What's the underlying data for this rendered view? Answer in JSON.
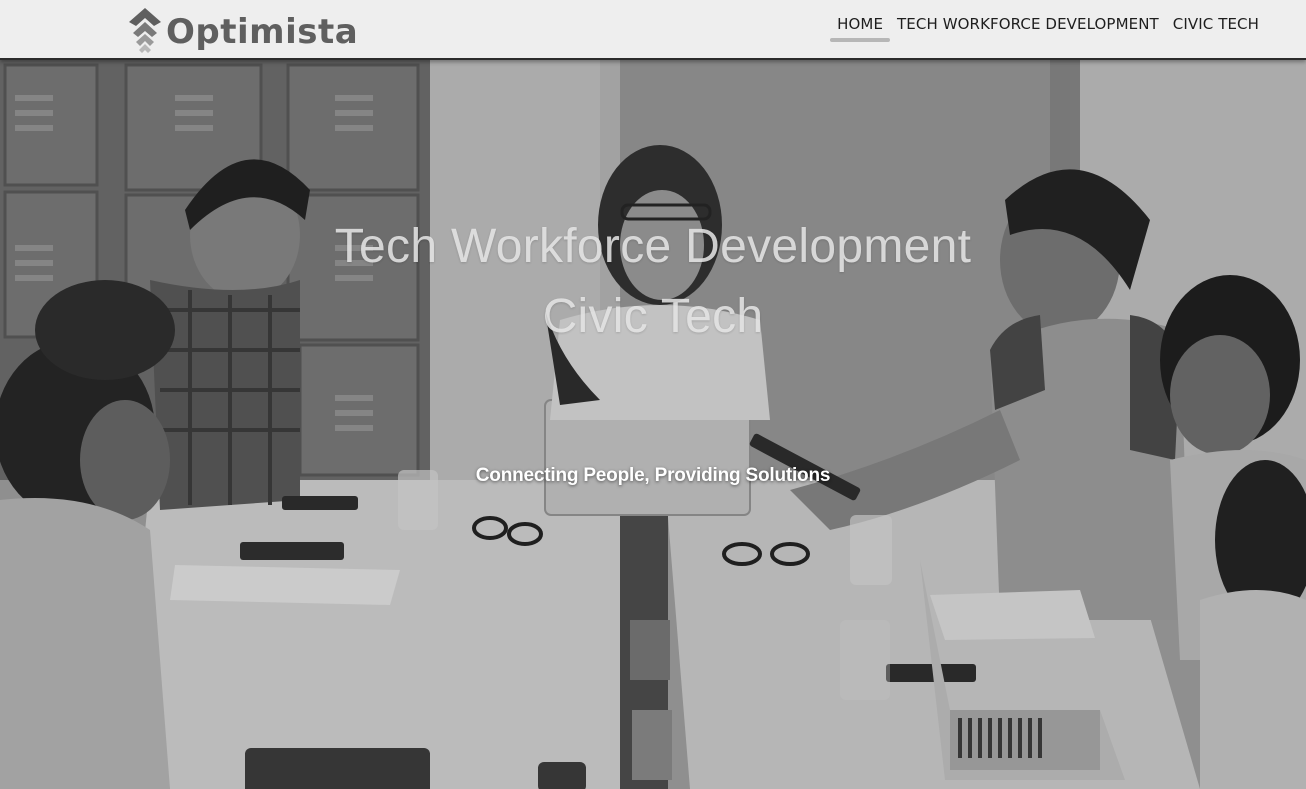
{
  "brand": {
    "name": "Optimista",
    "logo_icon": "chevron-up-stack-icon"
  },
  "nav": {
    "items": [
      {
        "label": "HOME",
        "active": true
      },
      {
        "label": "TECH WORKFORCE DEVELOPMENT",
        "active": false
      },
      {
        "label": "CIVIC TECH",
        "active": false
      }
    ]
  },
  "hero": {
    "title_line1": "Tech Workforce Development",
    "title_line2": "Civic Tech",
    "tagline": "Connecting People, Providing Solutions"
  },
  "colors": {
    "header_bg": "#eeeeee",
    "logo_text": "#5f5f5f",
    "nav_text": "#1e1e1e",
    "active_underline": "#b7b7b7"
  }
}
